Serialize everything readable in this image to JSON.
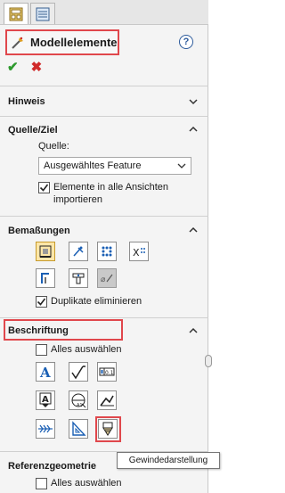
{
  "header": {
    "title": "Modellelemente",
    "help_label": "?"
  },
  "actions": {
    "ok_icon": "check-icon",
    "cancel_icon": "x-icon"
  },
  "sections": {
    "hinweis": {
      "title": "Hinweis"
    },
    "quelle_ziel": {
      "title": "Quelle/Ziel",
      "source_label": "Quelle:",
      "source_value": "Ausgewähltes Feature",
      "import_all_views": "Elemente in alle Ansichten importieren",
      "import_all_views_line1": "Elemente in alle Ansichten",
      "import_all_views_line2": "importieren",
      "import_all_views_checked": true
    },
    "bemassungen": {
      "title": "Bemaßungen",
      "remove_duplicates": "Duplikate eliminieren",
      "remove_duplicates_checked": true
    },
    "beschriftung": {
      "title": "Beschriftung",
      "select_all": "Alles auswählen",
      "select_all_checked": false
    },
    "referenzgeometrie": {
      "title": "Referenzgeometrie",
      "select_all": "Alles auswählen",
      "select_all_checked": false
    }
  },
  "tooltip": {
    "text": "Gewindedarstellung"
  },
  "colors": {
    "highlight": "#e0474c",
    "ok": "#2e9a2e",
    "cancel": "#d02a2a",
    "help": "#2c5a9b"
  }
}
